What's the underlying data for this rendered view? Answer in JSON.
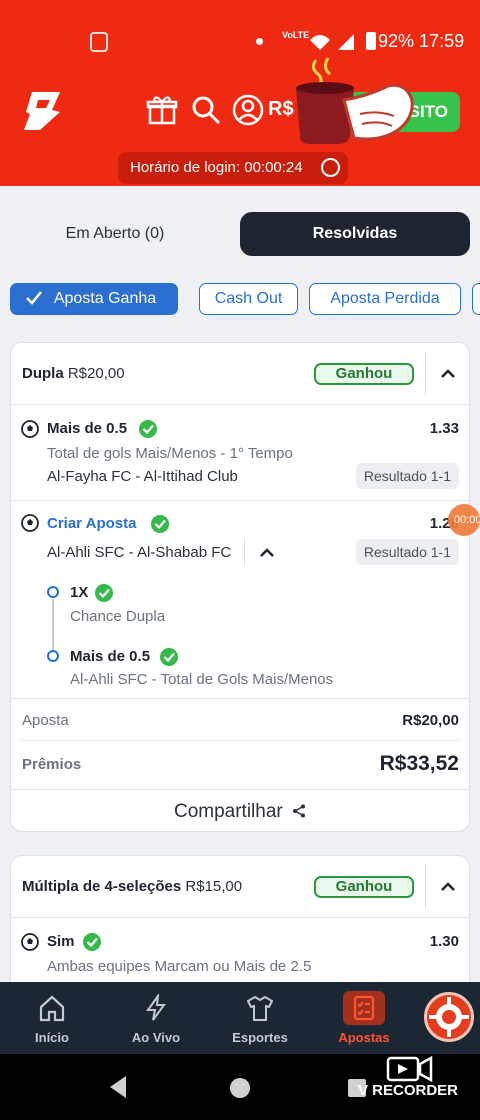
{
  "status_bar": {
    "battery": "92%",
    "time": "17:59",
    "network": "VoLTE"
  },
  "header": {
    "balance_text": "R$",
    "deposit_label": "SITO",
    "login_time_label": "Horário de login: 00:00:24"
  },
  "tabs": {
    "open": "Em Aberto (0)",
    "resolved": "Resolvidas"
  },
  "filters": [
    "Aposta Ganha",
    "Cash Out",
    "Aposta Perdida"
  ],
  "card1": {
    "type": "Dupla",
    "amount": "R$20,00",
    "status": "Ganhou",
    "selections": [
      {
        "title": "Mais de 0.5",
        "subtitle": "Total de gols Mais/Menos - 1° Tempo",
        "match": "Al-Fayha FC - Al-Ittihad Club",
        "odds": "1.33",
        "result": "Resultado 1-1"
      },
      {
        "title": "Criar Aposta",
        "match": "Al-Ahli SFC - Al-Shabab FC",
        "odds": "1.26",
        "result": "Resultado 1-1",
        "legs": [
          {
            "title": "1X",
            "subtitle": "Chance Dupla"
          },
          {
            "title": "Mais de 0.5",
            "subtitle": "Al-Ahli SFC - Total de Gols Mais/Menos"
          }
        ]
      }
    ],
    "stake_label": "Aposta",
    "stake_value": "R$20,00",
    "prize_label": "Prêmios",
    "prize_value": "R$33,52",
    "share_label": "Compartilhar"
  },
  "card2": {
    "type": "Múltipla de 4-seleções",
    "amount": "R$15,00",
    "status": "Ganhou",
    "selection": {
      "title": "Sim",
      "subtitle": "Ambas equipes Marcam ou Mais de 2.5",
      "odds": "1.30"
    }
  },
  "overlay_bubble": "00:00",
  "bottom_nav": [
    "Início",
    "Ao Vivo",
    "Esportes",
    "Apostas"
  ],
  "recorder_label": "V RECORDER",
  "colors": {
    "brand": "#ee2b12",
    "accent_blue": "#2b6fd0",
    "win_green": "#2a9a3c",
    "nav_bg": "#1d2633"
  }
}
